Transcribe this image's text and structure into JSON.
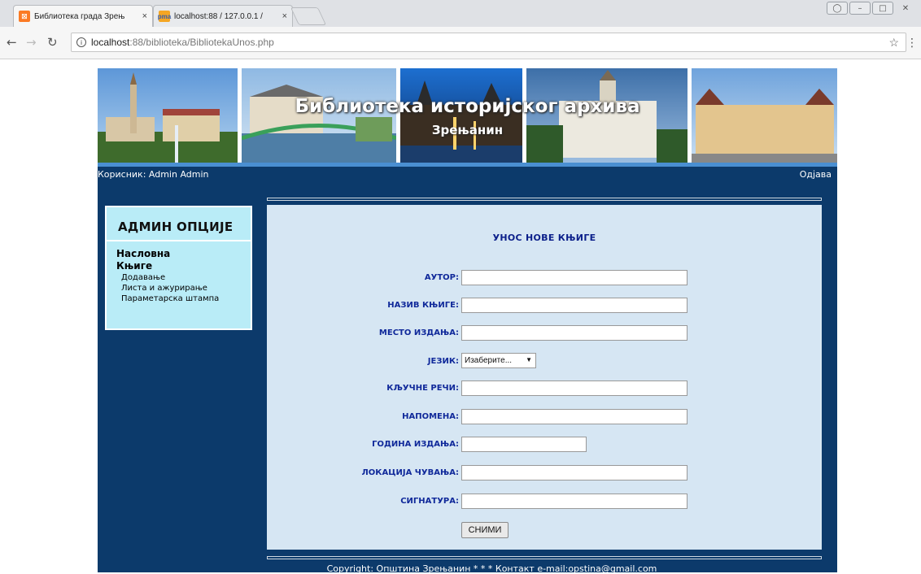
{
  "browser": {
    "tabs": [
      {
        "title": "Библиотека града Зрењ",
        "close": "×",
        "favicon": "xampp-icon"
      },
      {
        "title": "localhost:88 / 127.0.0.1 /",
        "close": "×",
        "favicon": "phpmyadmin-icon"
      }
    ],
    "url_host": "localhost",
    "url_path": ":88/biblioteka/BibliotekaUnos.php",
    "window_buttons": [
      "△",
      "–",
      "□",
      "✕"
    ]
  },
  "banner": {
    "title": "Библиотека историјског архива",
    "subtitle": "Зрењанин"
  },
  "userbar": {
    "user_label": "Корисник: Admin Admin",
    "logout": "Одјава"
  },
  "sidebar": {
    "title": "АДМИН ОПЦИЈЕ",
    "items": [
      {
        "label": "Насловна"
      },
      {
        "label": "Књиге"
      }
    ],
    "subitems": [
      {
        "label": "Додавање"
      },
      {
        "label": "Листа и ажурирање"
      },
      {
        "label": "Параметарска штампа"
      }
    ]
  },
  "form": {
    "title": "УНОС НОВЕ КЊИГЕ",
    "fields": [
      {
        "label": "АУТОР:",
        "value": ""
      },
      {
        "label": "НАЗИВ КЊИГЕ:",
        "value": ""
      },
      {
        "label": "МЕСТО ИЗДАЊА:",
        "value": ""
      },
      {
        "label": "ЈЕЗИК:",
        "selected": "Изаберите..."
      },
      {
        "label": "КЉУЧНЕ РЕЧИ:",
        "value": ""
      },
      {
        "label": "НАПОМЕНА:",
        "value": ""
      },
      {
        "label": "ГОДИНА ИЗДАЊА:",
        "value": ""
      },
      {
        "label": "ЛОКАЦИЈА ЧУВАЊА:",
        "value": ""
      },
      {
        "label": "СИГНАТУРА:",
        "value": ""
      }
    ],
    "submit_label": "СНИМИ"
  },
  "footer": {
    "text": "Copyright: Општина Зрењанин * * * Контакт e-mail:opstina@gmail.com"
  },
  "colors": {
    "page_background": "#0c3a6b",
    "sidebar_background": "#b9ecf7",
    "content_background": "#d6e6f3",
    "label_color": "#10299a"
  }
}
